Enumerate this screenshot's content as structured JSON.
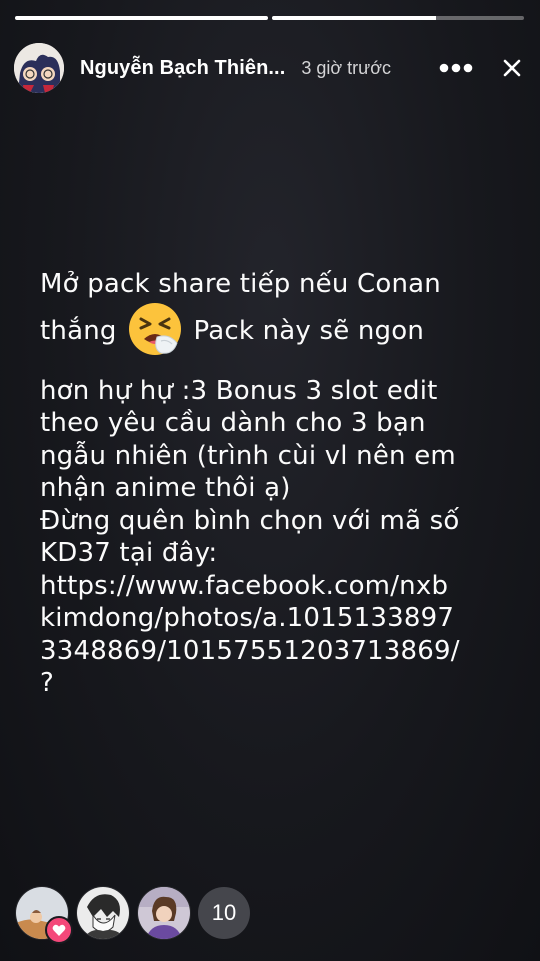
{
  "progress": [
    1.0,
    0.65
  ],
  "header": {
    "user_name": "Nguyễn Bạch Thiên...",
    "timestamp": "3 giờ trước",
    "more_icon": "more-dots-icon",
    "close_icon": "close-icon"
  },
  "story": {
    "lines": [
      "Mở pack share tiếp nếu Conan",
      "thắng",
      "Pack này sẽ ngon",
      "hơn hự hự :3 Bonus 3 slot edit",
      "theo yêu cầu dành cho 3 bạn",
      "ngẫu nhiên (trình cùi vl nên em",
      "nhận anime thôi ạ)",
      "Đừng quên bình chọn với mã số",
      "KD37 tại đây:",
      "https://www.facebook.com/nxb",
      "kimdong/photos/a.1015133897",
      "3348869/10157551203713869/",
      "?"
    ],
    "emoji": "tired-face-emoji"
  },
  "viewers": {
    "count": "10",
    "reaction": "heart-icon",
    "colors": {
      "reaction": "#f4487a",
      "count_bg": "#45464c"
    }
  }
}
